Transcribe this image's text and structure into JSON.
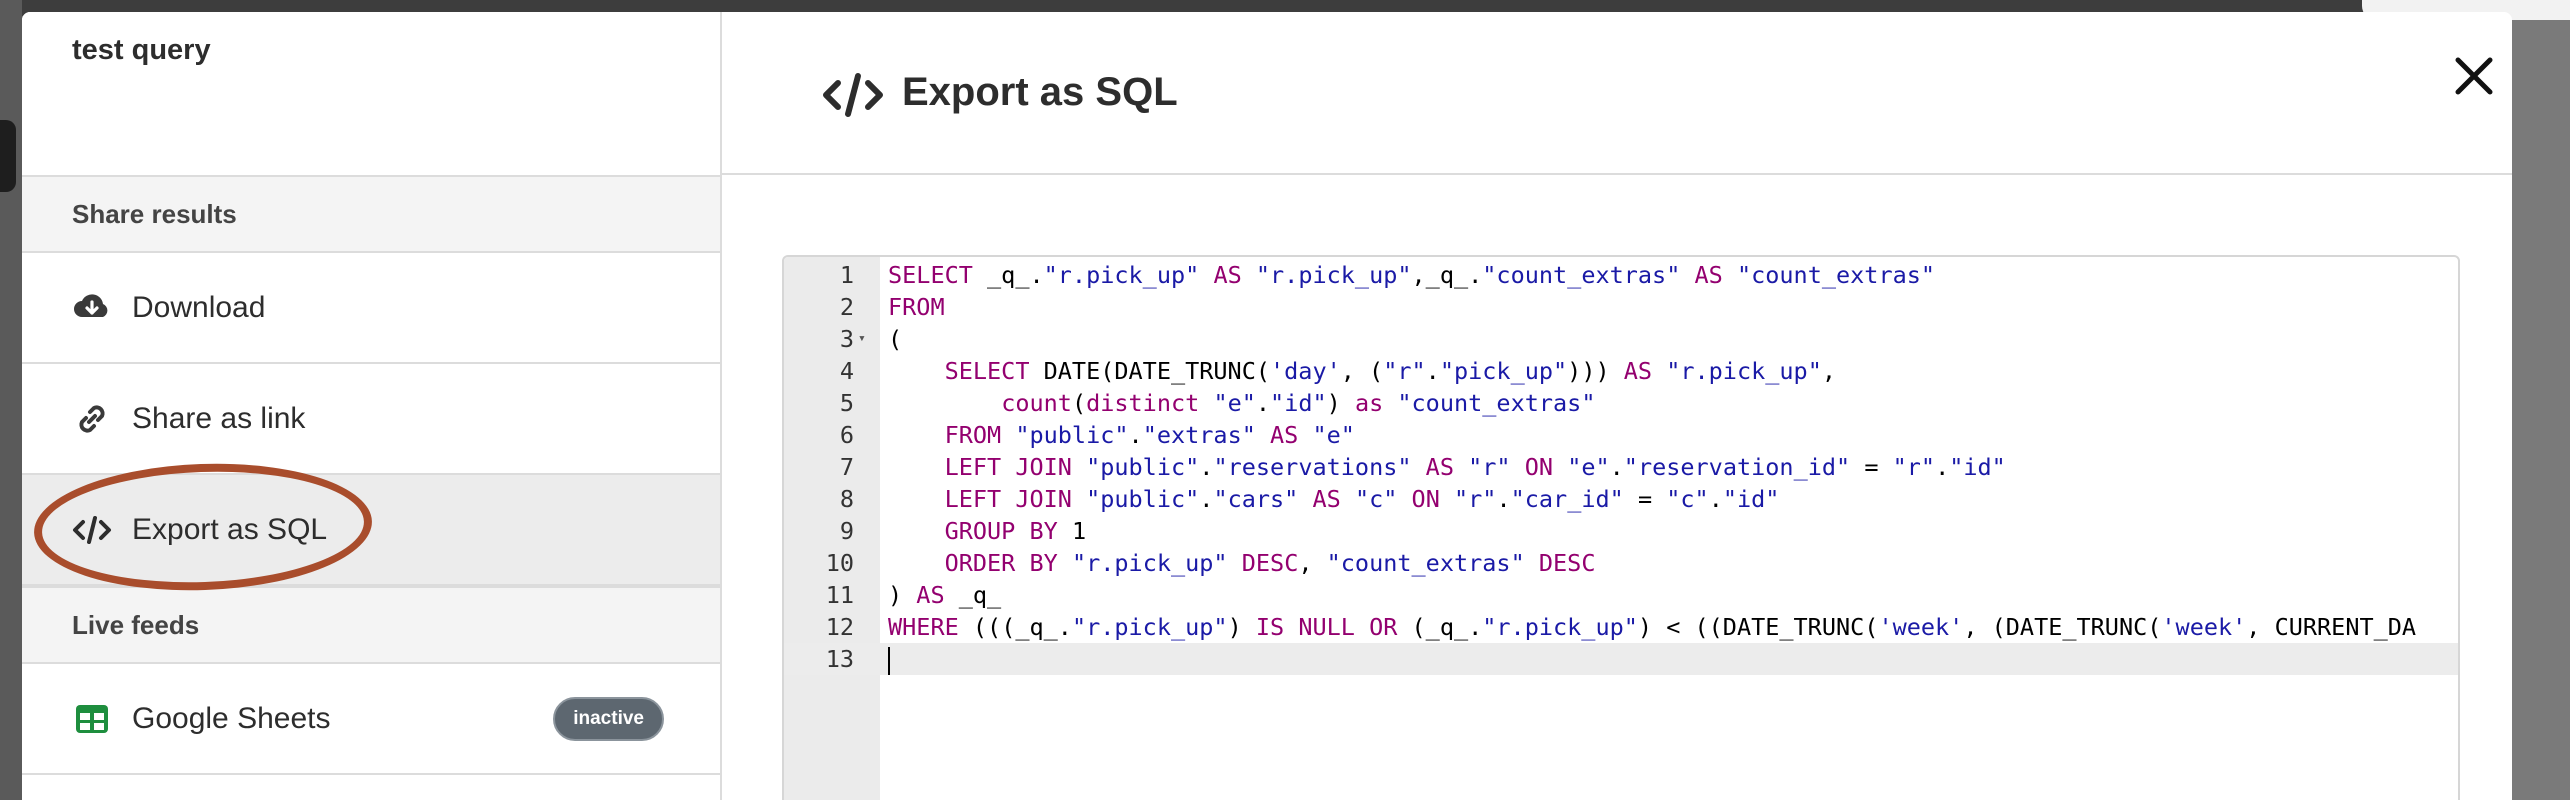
{
  "sidebar": {
    "query_title": "test query",
    "share_section": "Share results",
    "items": [
      {
        "label": "Download",
        "icon": "cloud-download-icon"
      },
      {
        "label": "Share as link",
        "icon": "link-icon"
      },
      {
        "label": "Export as SQL",
        "icon": "code-icon",
        "active": true
      }
    ],
    "live_section": "Live feeds",
    "feeds": [
      {
        "label": "Google Sheets",
        "icon": "google-sheets-icon",
        "status": "inactive"
      }
    ]
  },
  "main": {
    "title": "Export as SQL",
    "title_icon": "code-icon",
    "close_icon": "close-icon"
  },
  "editor": {
    "active_line": 13,
    "lines": [
      {
        "n": "1",
        "text": "SELECT _q_.\"r.pick_up\" AS \"r.pick_up\",_q_.\"count_extras\" AS \"count_extras\""
      },
      {
        "n": "2",
        "text": "FROM"
      },
      {
        "n": "3",
        "text": "(",
        "fold": true
      },
      {
        "n": "4",
        "text": "    SELECT DATE(DATE_TRUNC('day', (\"r\".\"pick_up\"))) AS \"r.pick_up\","
      },
      {
        "n": "5",
        "text": "        count(distinct \"e\".\"id\") as \"count_extras\""
      },
      {
        "n": "6",
        "text": "    FROM \"public\".\"extras\" AS \"e\""
      },
      {
        "n": "7",
        "text": "    LEFT JOIN \"public\".\"reservations\" AS \"r\" ON \"e\".\"reservation_id\" = \"r\".\"id\""
      },
      {
        "n": "8",
        "text": "    LEFT JOIN \"public\".\"cars\" AS \"c\" ON \"r\".\"car_id\" = \"c\".\"id\""
      },
      {
        "n": "9",
        "text": "    GROUP BY 1"
      },
      {
        "n": "10",
        "text": "    ORDER BY \"r.pick_up\" DESC, \"count_extras\" DESC"
      },
      {
        "n": "11",
        "text": ") AS _q_"
      },
      {
        "n": "12",
        "text": "WHERE (((_q_.\"r.pick_up\") IS NULL OR (_q_.\"r.pick_up\") < ((DATE_TRUNC('week', (DATE_TRUNC('week', CURRENT_DA"
      },
      {
        "n": "13",
        "text": ""
      }
    ]
  },
  "colors": {
    "annotation": "#a94d2c",
    "keyword": "#93006f",
    "string": "#1a1aa6",
    "sheets_green": "#1e8e3e",
    "badge_bg": "#5d6770"
  }
}
